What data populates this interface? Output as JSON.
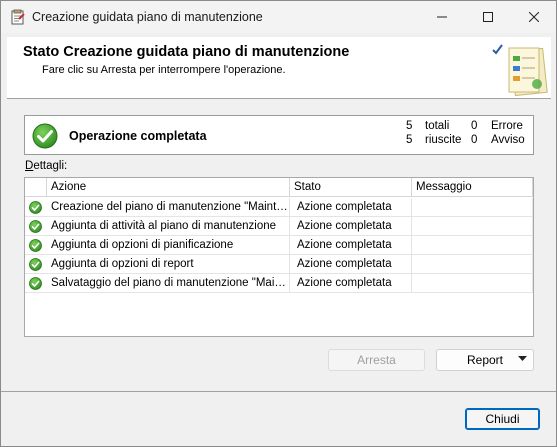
{
  "window": {
    "title": "Creazione guidata piano di manutenzione",
    "icon": "maintenance-wizard-icon"
  },
  "banner": {
    "title": "Stato Creazione guidata piano di manutenzione",
    "subtitle": "Fare clic su Arresta per interrompere l'operazione."
  },
  "status": {
    "text": "Operazione completata",
    "total_count": "5",
    "total_label": "totali",
    "success_count": "5",
    "success_label": "riuscite",
    "error_count": "0",
    "error_label": "Errore",
    "warning_count": "0",
    "warning_label": "Avviso",
    "icon": "success-check-icon"
  },
  "details": {
    "label_prefix": "D",
    "label_rest": "ettagli:",
    "columns": [
      "Azione",
      "Stato",
      "Messaggio"
    ],
    "rows": [
      {
        "action": "Creazione del piano di manutenzione \"Mainten...",
        "state": "Azione completata",
        "message": ""
      },
      {
        "action": "Aggiunta di attività al piano di manutenzione",
        "state": "Azione completata",
        "message": ""
      },
      {
        "action": "Aggiunta di opzioni di pianificazione",
        "state": "Azione completata",
        "message": ""
      },
      {
        "action": "Aggiunta di opzioni di report",
        "state": "Azione completata",
        "message": ""
      },
      {
        "action": "Salvataggio del piano di manutenzione \"Maint...",
        "state": "Azione completata",
        "message": ""
      }
    ]
  },
  "buttons": {
    "stop_prefix": "",
    "stop_label": "Arresta",
    "report_label": "Report",
    "close_label": "Chiudi"
  },
  "colors": {
    "success_green": "#3a9b2e",
    "accent_blue": "#0067c0"
  }
}
